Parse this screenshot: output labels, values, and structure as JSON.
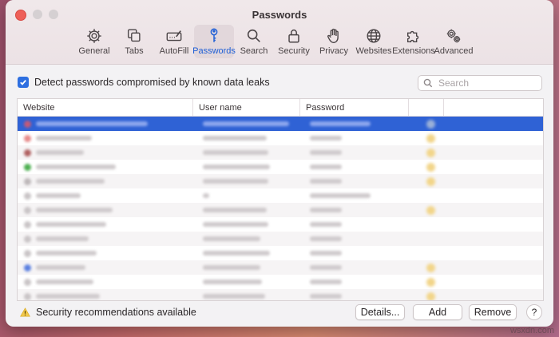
{
  "window": {
    "title": "Passwords"
  },
  "toolbar": {
    "items": [
      {
        "label": "General",
        "icon": "gear-icon"
      },
      {
        "label": "Tabs",
        "icon": "tabs-icon"
      },
      {
        "label": "AutoFill",
        "icon": "autofill-icon"
      },
      {
        "label": "Passwords",
        "icon": "key-icon",
        "active": true
      },
      {
        "label": "Search",
        "icon": "search-icon"
      },
      {
        "label": "Security",
        "icon": "lock-icon"
      },
      {
        "label": "Privacy",
        "icon": "hand-icon"
      },
      {
        "label": "Websites",
        "icon": "globe-icon"
      },
      {
        "label": "Extensions",
        "icon": "puzzle-icon"
      },
      {
        "label": "Advanced",
        "icon": "gears-icon"
      }
    ]
  },
  "detect": {
    "checked": true,
    "label": "Detect passwords compromised by known data leaks"
  },
  "search": {
    "placeholder": "Search",
    "value": ""
  },
  "table": {
    "columns": [
      "Website",
      "User name",
      "Password",
      "",
      ""
    ]
  },
  "footer": {
    "recommendation": "Security recommendations available",
    "details_label": "Details...",
    "add_label": "Add",
    "remove_label": "Remove",
    "help_label": "?"
  },
  "watermark": "wsxdn.com",
  "colors": {
    "accent": "#2f62d5",
    "close": "#ee5f58",
    "warning": "#f2c94c"
  }
}
